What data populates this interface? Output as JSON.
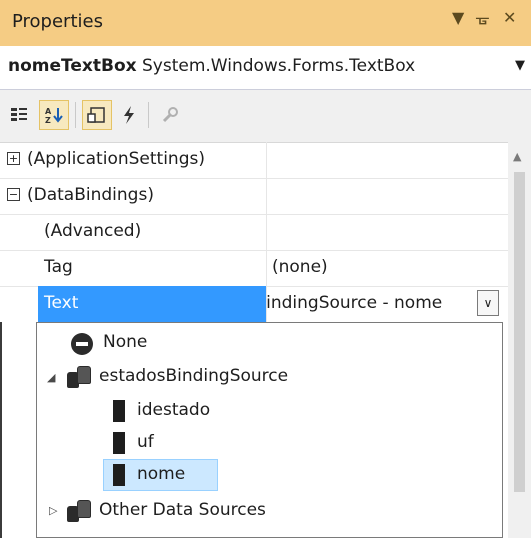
{
  "panel": {
    "title": "Properties",
    "controls": {
      "pin": "▼",
      "dock": "ᚗ",
      "close": "✕"
    }
  },
  "object_selector": {
    "name": "nomeTextBox",
    "type": "System.Windows.Forms.TextBox"
  },
  "toolbar": {
    "buttons": [
      {
        "icon": "categorized-icon",
        "active": false
      },
      {
        "icon": "alphabetical-icon",
        "active": true
      },
      {
        "icon": "properties-icon",
        "active": true
      },
      {
        "icon": "events-icon",
        "active": false
      },
      {
        "icon": "property-pages-icon",
        "active": false
      }
    ]
  },
  "grid": {
    "rows": [
      {
        "name": "(ApplicationSettings)",
        "value": "",
        "expander": "+",
        "selected": false
      },
      {
        "name": "(DataBindings)",
        "value": "",
        "expander": "−",
        "selected": false
      },
      {
        "name": "(Advanced)",
        "value": "",
        "selected": false
      },
      {
        "name": "Tag",
        "value": "(none)",
        "selected": false
      },
      {
        "name": "Text",
        "value": "estadosBindingSource - nome",
        "selected": true
      }
    ]
  },
  "dropdown_tree": {
    "items": [
      {
        "label": "None",
        "icon": "none-icon"
      },
      {
        "label": "estadosBindingSource",
        "icon": "datasource-icon",
        "expanded": true
      },
      {
        "label": "idestado",
        "icon": "field-icon"
      },
      {
        "label": "uf",
        "icon": "field-icon"
      },
      {
        "label": "nome",
        "icon": "field-icon",
        "selected": true
      },
      {
        "label": "Other Data Sources",
        "icon": "datasource-icon",
        "expanded": false
      }
    ]
  },
  "colors": {
    "title_bar": "#f5cc84",
    "selection": "#3399ff",
    "tree_highlight": "#cce8ff"
  }
}
